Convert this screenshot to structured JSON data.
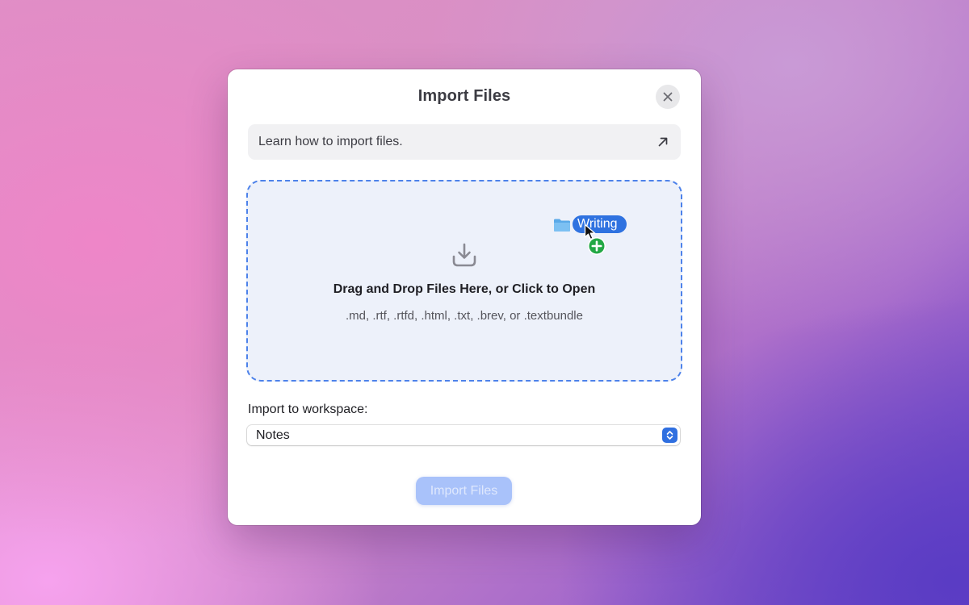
{
  "dialog": {
    "title": "Import Files",
    "close_icon": "close-icon"
  },
  "learn_banner": {
    "label": "Learn how to import files.",
    "icon": "arrow-up-right-icon"
  },
  "dropzone": {
    "icon": "download-tray-icon",
    "primary_text": "Drag and Drop Files Here, or Click to Open",
    "secondary_text": ".md, .rtf, .rtfd, .html, .txt, .brev, or .textbundle",
    "drag_item": {
      "icon": "folder-icon",
      "label": "Writing",
      "badge_icon": "add-badge-icon"
    }
  },
  "workspace": {
    "label": "Import to workspace:",
    "selected": "Notes"
  },
  "footer": {
    "import_label": "Import Files",
    "import_enabled": false
  },
  "colors": {
    "accent": "#2f72e0",
    "dropzone_border": "#4d82ea",
    "dropzone_bg": "#edf1fa",
    "disabled_button": "#a9c2fa",
    "add_badge": "#23a845"
  }
}
